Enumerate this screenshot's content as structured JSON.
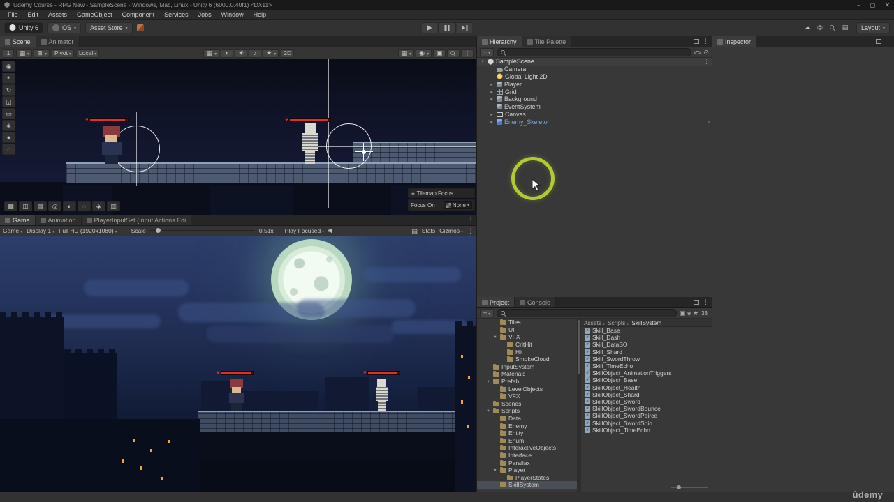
{
  "window": {
    "title": "Udemy Course - RPG New - SampleScene - Windows, Mac, Linux - Unity 6 (6000.0.40f1) <DX11>",
    "minimize": "–",
    "maximize": "▢",
    "close": "✕"
  },
  "menu": {
    "items": [
      "File",
      "Edit",
      "Assets",
      "GameObject",
      "Component",
      "Services",
      "Jobs",
      "Window",
      "Help"
    ]
  },
  "main_toolbar": {
    "unity_badge": "Unity 6",
    "account_label": "OS",
    "asset_store_label": "Asset Store",
    "layout_label": "Layout",
    "right_icons": [
      {
        "name": "cloud-icon",
        "glyph": "☁"
      },
      {
        "name": "notifications-icon",
        "glyph": "◎"
      },
      {
        "name": "search-icon",
        "icon": "mag",
        "glyph": ""
      },
      {
        "name": "layers-icon",
        "glyph": "▤"
      }
    ]
  },
  "scene_panel": {
    "tabs": [
      {
        "label": "Scene",
        "active": true
      },
      {
        "label": "Animator",
        "active": false
      }
    ],
    "toolbar": {
      "snap_value": "1",
      "pivot_label": "Pivot",
      "local_label": "Local",
      "mode_2d": "2D"
    },
    "toolbar_left_icons": [
      {
        "name": "grid-snap-icon",
        "glyph": "▦",
        "caret": true
      },
      {
        "name": "move-snap-icon",
        "glyph": "⊞",
        "caret": true
      }
    ],
    "toolbar_center_icons": [
      {
        "name": "draw-mode-icon",
        "glyph": "▦",
        "caret": true
      },
      {
        "name": "skybox-toggle-icon",
        "glyph": "◐"
      },
      {
        "name": "lighting-toggle-icon",
        "glyph": "☀"
      },
      {
        "name": "audio-toggle-icon",
        "glyph": "♪"
      },
      {
        "name": "effects-toggle-icon",
        "glyph": "★",
        "caret": true
      }
    ],
    "toolbar_right_icons": [
      {
        "name": "grid-visibility-icon",
        "glyph": "▦",
        "caret": true
      },
      {
        "name": "gizmos-dropdown-icon",
        "glyph": "◉",
        "caret": true
      },
      {
        "name": "camera-settings-icon",
        "glyph": "▣"
      },
      {
        "name": "search-icon",
        "icon": "mag",
        "glyph": ""
      },
      {
        "name": "overflow-menu-icon",
        "glyph": "⋮"
      }
    ],
    "tools": [
      {
        "name": "view-tool",
        "glyph": "◉"
      },
      {
        "name": "move-tool",
        "glyph": "+"
      },
      {
        "name": "rotate-tool",
        "glyph": "↻"
      },
      {
        "name": "scale-tool",
        "glyph": "◱"
      },
      {
        "name": "rect-tool",
        "glyph": "▭"
      },
      {
        "name": "transform-tool",
        "glyph": "◈"
      },
      {
        "name": "custom-tool",
        "glyph": "●"
      },
      {
        "name": "more-tools",
        "glyph": "◌"
      }
    ],
    "overlay_buttons": [
      {
        "name": "overlay-grid",
        "glyph": "▦"
      },
      {
        "name": "overlay-move",
        "glyph": "◫"
      },
      {
        "name": "overlay-rows",
        "glyph": "▤"
      },
      {
        "name": "overlay-orientation",
        "glyph": "◎"
      },
      {
        "name": "overlay-light",
        "glyph": "◐"
      },
      {
        "name": "overlay-search",
        "glyph": "◌"
      },
      {
        "name": "overlay-camera",
        "glyph": "◈"
      },
      {
        "name": "overlay-more",
        "glyph": "▥"
      }
    ],
    "tilemap_focus": {
      "handle": "≡",
      "title": "Tilemap Focus",
      "label": "Focus On",
      "value": "None"
    }
  },
  "game_panel": {
    "tabs": [
      {
        "label": "Game",
        "active": true
      },
      {
        "label": "Animation",
        "active": false
      },
      {
        "label": "PlayerInputSet (Input Actions Edi",
        "active": false
      }
    ],
    "toolbar": {
      "view_mode": "Game",
      "display": "Display 1",
      "resolution": "Full HD (1920x1080)",
      "scale_label": "Scale",
      "scale_value": "0.51x",
      "play_focused": "Play Focused",
      "stats_label": "Stats",
      "gizmos_label": "Gizmos"
    }
  },
  "hierarchy": {
    "tabs": [
      {
        "label": "Hierarchy",
        "active": true
      },
      {
        "label": "Tile Palette",
        "active": false
      }
    ],
    "create_label": "+",
    "search_placeholder": "",
    "root": {
      "label": "SampleScene",
      "icon": "unity",
      "arrow": "▾"
    },
    "items": [
      {
        "label": "Camera",
        "icon": "camera",
        "indent": 1
      },
      {
        "label": "Global Light 2D",
        "icon": "light",
        "indent": 1
      },
      {
        "label": "Player",
        "icon": "cube",
        "indent": 1,
        "arrow": "▸"
      },
      {
        "label": "Grid",
        "icon": "grid",
        "indent": 1,
        "arrow": "▸"
      },
      {
        "label": "Background",
        "icon": "cube",
        "indent": 1,
        "arrow": "▸"
      },
      {
        "label": "EventSystem",
        "icon": "cube",
        "indent": 1
      },
      {
        "label": "Canvas",
        "icon": "canvas",
        "indent": 1,
        "arrow": "▸"
      },
      {
        "label": "Enemy_Skeleton",
        "icon": "prefab",
        "indent": 1,
        "arrow": "▸",
        "cls": "prefab",
        "chevron": "›"
      }
    ]
  },
  "inspector": {
    "tabs": [
      {
        "label": "Inspector",
        "active": true
      }
    ]
  },
  "project": {
    "tabs": [
      {
        "label": "Project",
        "active": true
      },
      {
        "label": "Console",
        "active": false
      }
    ],
    "create_label": "+",
    "count_badge": "33",
    "toolbar_icons": [
      {
        "name": "type-filter-icon",
        "glyph": "▣"
      },
      {
        "name": "label-filter-icon",
        "glyph": "◈"
      },
      {
        "name": "favorite-filter-icon",
        "glyph": "★"
      }
    ],
    "folders": [
      {
        "label": "Tiles",
        "icon": "folder",
        "indent": 2
      },
      {
        "label": "UI",
        "icon": "folder",
        "indent": 2
      },
      {
        "label": "VFX",
        "icon": "folder",
        "indent": 2,
        "arrow": "▾"
      },
      {
        "label": "CritHit",
        "icon": "folder",
        "indent": 3
      },
      {
        "label": "Hit",
        "icon": "folder",
        "indent": 3
      },
      {
        "label": "SmokeCloud",
        "icon": "folder",
        "indent": 3
      },
      {
        "label": "InputSystem",
        "icon": "folder",
        "indent": 1
      },
      {
        "label": "Materials",
        "icon": "folder",
        "indent": 1
      },
      {
        "label": "Prefab",
        "icon": "folder",
        "indent": 1,
        "arrow": "▾"
      },
      {
        "label": "LevelObjects",
        "icon": "folder",
        "indent": 2
      },
      {
        "label": "VFX",
        "icon": "folder",
        "indent": 2
      },
      {
        "label": "Scenes",
        "icon": "folder",
        "indent": 1
      },
      {
        "label": "Scripts",
        "icon": "folder",
        "indent": 1,
        "arrow": "▾"
      },
      {
        "label": "Data",
        "icon": "folder",
        "indent": 2
      },
      {
        "label": "Enemy",
        "icon": "folder",
        "indent": 2
      },
      {
        "label": "Entity",
        "icon": "folder",
        "indent": 2
      },
      {
        "label": "Enum",
        "icon": "folder",
        "indent": 2
      },
      {
        "label": "InteractiveObjects",
        "icon": "folder",
        "indent": 2
      },
      {
        "label": "Interface",
        "icon": "folder",
        "indent": 2
      },
      {
        "label": "Parallax",
        "icon": "folder",
        "indent": 2
      },
      {
        "label": "Player",
        "icon": "folder",
        "indent": 2,
        "arrow": "▾"
      },
      {
        "label": "PlayerStates",
        "icon": "folder",
        "indent": 3
      },
      {
        "label": "SkillSystem",
        "icon": "folder",
        "indent": 2,
        "selected": true
      }
    ],
    "breadcrumb": [
      {
        "label": "Assets"
      },
      {
        "label": "Scripts"
      },
      {
        "label": "SkillSystem"
      }
    ],
    "files": [
      {
        "label": "Skill_Base",
        "icon": "cs"
      },
      {
        "label": "Skill_Dash",
        "icon": "cs"
      },
      {
        "label": "Skill_DataSO",
        "icon": "cs"
      },
      {
        "label": "Skill_Shard",
        "icon": "cs"
      },
      {
        "label": "Skill_SwordThrow",
        "icon": "cs"
      },
      {
        "label": "Skill_TimeEcho",
        "icon": "cs"
      },
      {
        "label": "SkillObject_AnimationTriggers",
        "icon": "cs"
      },
      {
        "label": "SkillObject_Base",
        "icon": "cs"
      },
      {
        "label": "SkillObject_Health",
        "icon": "cs"
      },
      {
        "label": "SkillObject_Shard",
        "icon": "cs"
      },
      {
        "label": "SkillObject_Sword",
        "icon": "cs"
      },
      {
        "label": "SkillObject_SwordBounce",
        "icon": "cs"
      },
      {
        "label": "SkillObject_SwordPeirce",
        "icon": "cs"
      },
      {
        "label": "SkillObject_SwordSpin",
        "icon": "cs"
      },
      {
        "label": "SkillObject_TimeEcho",
        "icon": "cs"
      }
    ]
  },
  "status": {
    "watermark": "ûdemy"
  }
}
